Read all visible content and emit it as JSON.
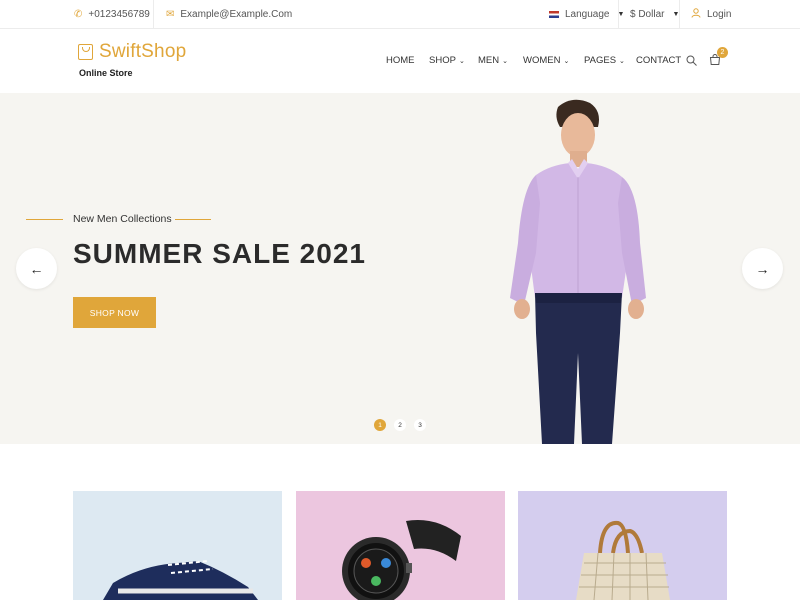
{
  "topbar": {
    "phone": "+0123456789",
    "email": "Example@Example.Com",
    "language": "Language",
    "currency": "$ Dollar",
    "login": "Login"
  },
  "header": {
    "brand": "SwiftShop",
    "tagline": "Online Store",
    "nav": [
      {
        "label": "HOME",
        "has_dropdown": false
      },
      {
        "label": "SHOP",
        "has_dropdown": true
      },
      {
        "label": "MEN",
        "has_dropdown": true
      },
      {
        "label": "WOMEN",
        "has_dropdown": true
      },
      {
        "label": "PAGES",
        "has_dropdown": true
      },
      {
        "label": "CONTACT",
        "has_dropdown": false
      }
    ],
    "cart_count": "2"
  },
  "hero": {
    "subtitle": "New Men Collections",
    "title": "SUMMER SALE 2021",
    "button": "SHOP NOW",
    "prev_arrow": "←",
    "next_arrow": "→",
    "slides": [
      "1",
      "2",
      "3"
    ],
    "active_slide": "1"
  },
  "products": [
    {
      "name": "sneaker",
      "bg": "#dde9f2"
    },
    {
      "name": "smartwatch",
      "bg": "#ecc6df"
    },
    {
      "name": "handbag",
      "bg": "#d4cdee"
    }
  ],
  "colors": {
    "accent": "#e0a63a",
    "hero_bg": "#f6f5f1"
  }
}
